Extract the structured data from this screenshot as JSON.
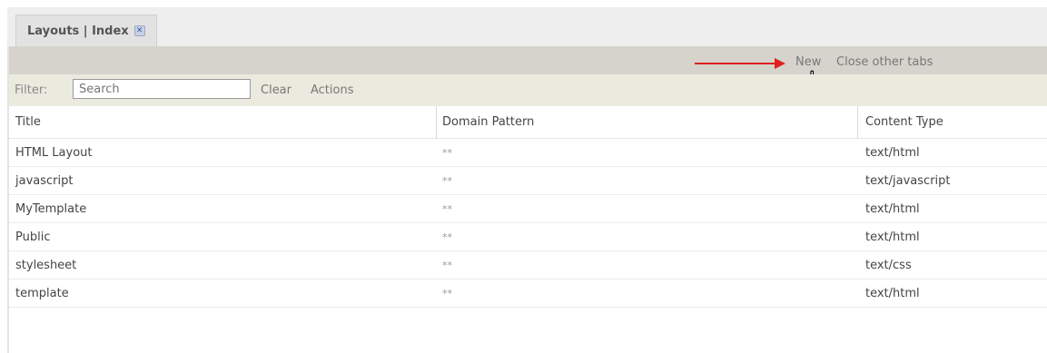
{
  "tab": {
    "title": "Layouts | Index",
    "close_icon": "close-icon"
  },
  "toolbar": {
    "new_label": "New",
    "close_other_label": "Close other tabs"
  },
  "filter": {
    "label": "Filter:",
    "placeholder": "Search",
    "clear_label": "Clear",
    "actions_label": "Actions"
  },
  "grid": {
    "columns": [
      "Title",
      "Domain Pattern",
      "Content Type"
    ],
    "rows": [
      {
        "title": "HTML Layout",
        "domain": "**",
        "type": "text/html"
      },
      {
        "title": "javascript",
        "domain": "**",
        "type": "text/javascript"
      },
      {
        "title": "MyTemplate",
        "domain": "**",
        "type": "text/html"
      },
      {
        "title": "Public",
        "domain": "**",
        "type": "text/html"
      },
      {
        "title": "stylesheet",
        "domain": "**",
        "type": "text/css"
      },
      {
        "title": "template",
        "domain": "**",
        "type": "text/html"
      }
    ]
  },
  "annotation": {
    "arrow_color": "#e02020",
    "cursor_icon": "hand-pointer-icon"
  }
}
